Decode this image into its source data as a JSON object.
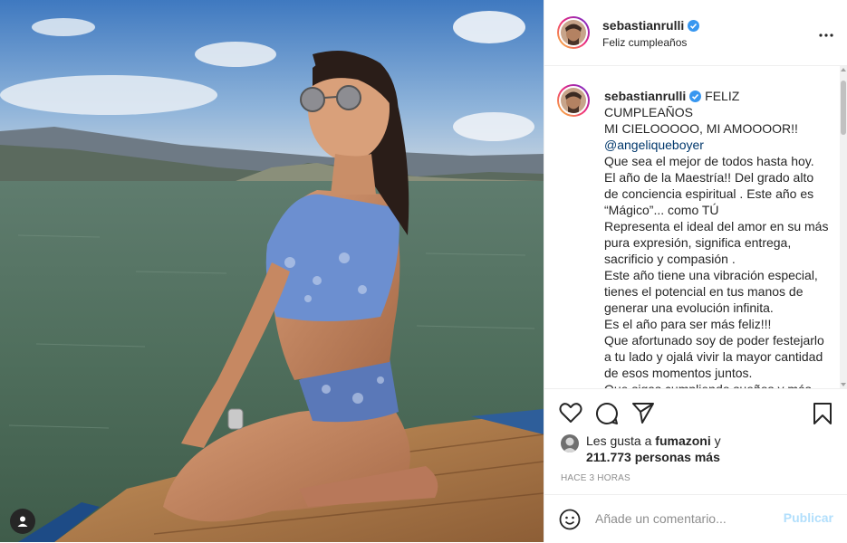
{
  "post": {
    "author": "sebastianrulli",
    "subtitle": "Feliz cumpleaños",
    "caption_line1": "FELIZ CUMPLEAÑOS",
    "caption_text": "MI CIELOOOOO, MI AMOOOOR!!",
    "mention": "@angeliqueboyer",
    "caption_body": "Que sea el mejor de todos hasta hoy.\nEl año de la Maestría!! Del grado alto de conciencia espiritual . Este año es “Mágico”... como TÚ\nRepresenta el ideal del amor en su más pura expresión, significa entrega, sacrificio y compasión .\nEste año tiene una vibración especial, tienes el potencial en tus manos de generar una evolución infinita.\nEs el año para ser más feliz!!!\nQue afortunado soy de poder festejarlo a tu lado y ojalá vivir la mayor cantidad de esos momentos juntos.\nQue sigas cumpliendo sueños y más"
  },
  "likes": {
    "prefix": "Les gusta a",
    "liker": "fumazoni",
    "connector": "y",
    "count": "211.773 personas más"
  },
  "timestamp": "HACE 3 HORAS",
  "comment": {
    "placeholder": "Añade un comentario...",
    "publish_label": "Publicar"
  },
  "icons": {
    "like": "heart-icon",
    "comment": "comment-icon",
    "share": "send-icon",
    "save": "bookmark-icon",
    "more": "more-options-icon",
    "emoji": "emoji-icon",
    "tag": "user-tag-icon",
    "verified": "verified-badge-icon"
  },
  "colors": {
    "link": "#00376b",
    "publish_disabled": "#b2dffc",
    "verified": "#3897f0",
    "muted": "#8e8e8e"
  }
}
